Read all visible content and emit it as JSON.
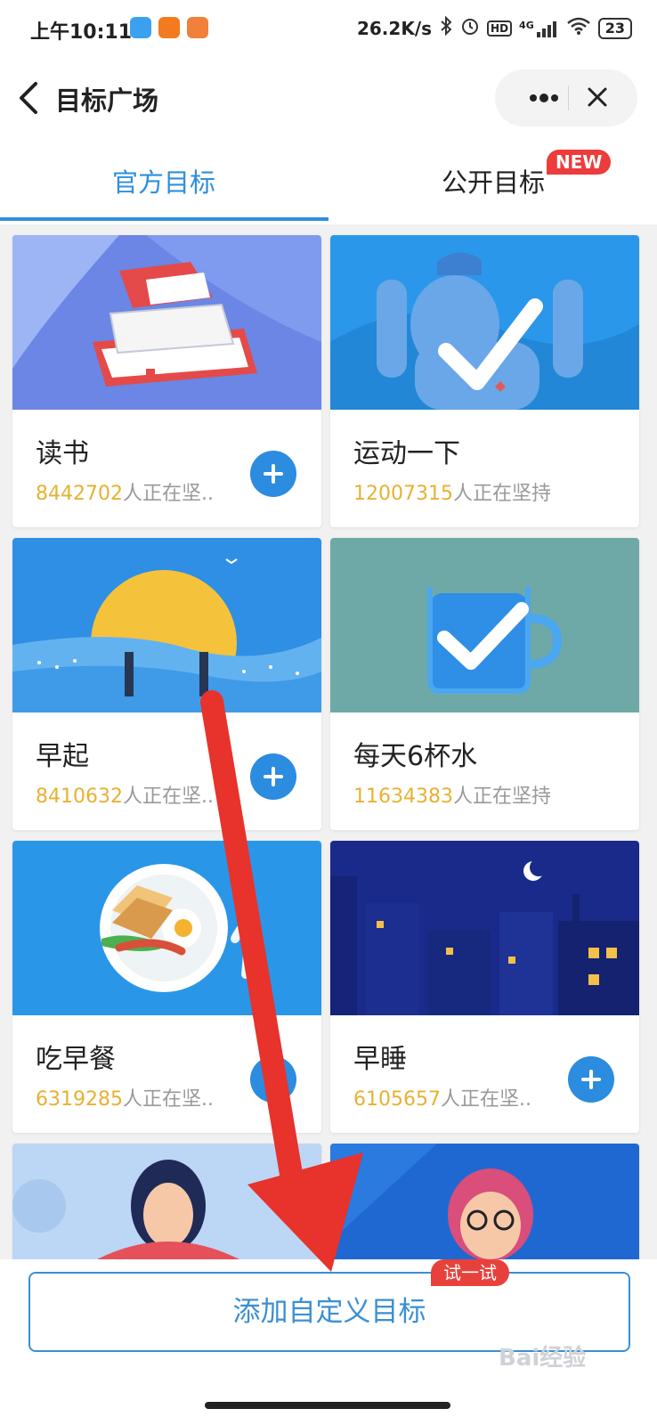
{
  "status_bar": {
    "time": "上午10:11",
    "net_speed": "26.2K/s",
    "battery": "23",
    "network": "4G",
    "icons": [
      "app-icon-blue",
      "taobao-icon",
      "heart-app-icon",
      "bluetooth-icon",
      "alarm-icon",
      "hd-icon",
      "signal-icon",
      "wifi-icon",
      "battery-icon"
    ]
  },
  "navbar": {
    "title": "目标广场",
    "icons": [
      "back-arrow-icon",
      "more-icon",
      "close-icon"
    ]
  },
  "tabs": [
    {
      "label": "官方目标",
      "active": true
    },
    {
      "label": "公开目标",
      "badge": "NEW",
      "active": false
    }
  ],
  "goals": [
    {
      "name": "读书",
      "count": "8442702",
      "suffix": "人正在坚..",
      "image": "books-illustration"
    },
    {
      "name": "运动一下",
      "count": "12007315",
      "suffix": "人正在坚持",
      "image": "exercise-illustration"
    },
    {
      "name": "早起",
      "count": "8410632",
      "suffix": "人正在坚..",
      "image": "sunrise-illustration"
    },
    {
      "name": "每天6杯水",
      "count": "11634383",
      "suffix": "人正在坚持",
      "image": "water-cup-illustration"
    },
    {
      "name": "吃早餐",
      "count": "6319285",
      "suffix": "人正在坚..",
      "image": "breakfast-illustration"
    },
    {
      "name": "早睡",
      "count": "6105657",
      "suffix": "人正在坚..",
      "image": "night-city-illustration"
    }
  ],
  "bottom": {
    "add_button": "添加自定义目标",
    "try_badge": "试一试"
  },
  "watermark": "Bai经验",
  "colors": {
    "primary": "#2e8fdb",
    "count_highlight": "#e7b132",
    "badge_red": "#ee3b3b",
    "annotation_arrow": "#e8322c"
  }
}
